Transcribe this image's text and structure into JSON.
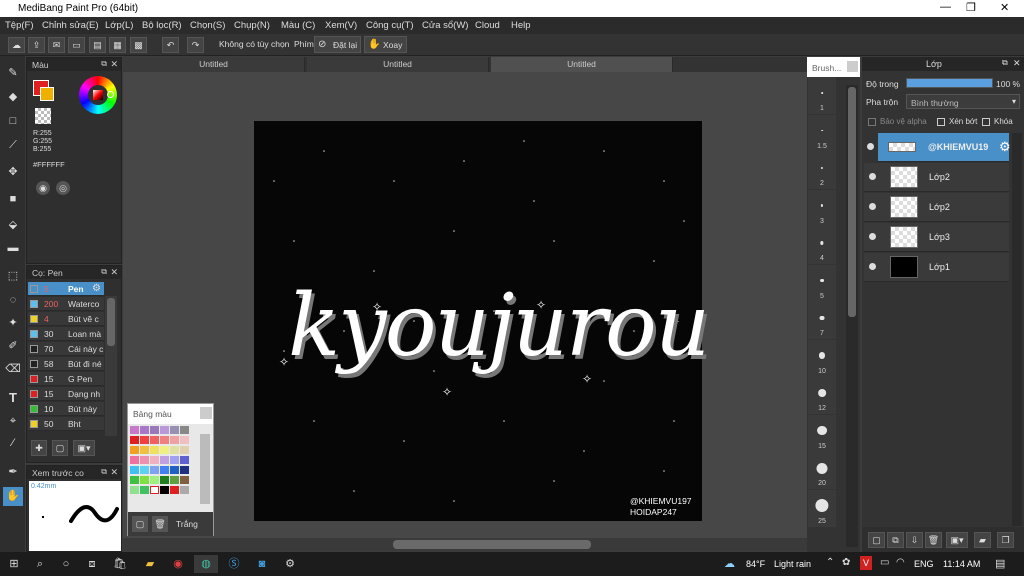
{
  "app": {
    "title": "MediBang Paint Pro (64bit)"
  },
  "menu": [
    "Tệp(F)",
    "Chỉnh sửa(E)",
    "Lớp(L)",
    "Bộ lọc(R)",
    "Chọn(S)",
    "Chụp(N)",
    "Màu (C)",
    "Xem(V)",
    "Công cụ(T)",
    "Cửa sổ(W)",
    "Cloud",
    "Help"
  ],
  "toolbar": {
    "selection_label": "Không có tùy chọn",
    "shortcut_label": "Phím",
    "reset_label": "Đặt lại",
    "rotate_label": "Xoay"
  },
  "color_panel": {
    "title": "Màu",
    "r": "R:255",
    "g": "G:255",
    "b": "B:255",
    "hex": "#FFFFFF"
  },
  "pen_panel": {
    "title": "Cọ: Pen",
    "items": [
      {
        "size": "5",
        "name": "Pen",
        "color": "#4a90c8"
      },
      {
        "size": "200",
        "name": "Waterco",
        "color": "#5bc0f0"
      },
      {
        "size": "4",
        "name": "Bút vẽ c",
        "color": "#f0d020"
      },
      {
        "size": "30",
        "name": "Loan mà",
        "color": "#5bc0f0"
      },
      {
        "size": "70",
        "name": "Cái này c",
        "color": "#222222"
      },
      {
        "size": "58",
        "name": "Bút đi né",
        "color": "#222222"
      },
      {
        "size": "15",
        "name": "G Pen",
        "color": "#e02020"
      },
      {
        "size": "15",
        "name": "Dạng nh",
        "color": "#e02020"
      },
      {
        "size": "10",
        "name": "Bút này",
        "color": "#30c030"
      },
      {
        "size": "50",
        "name": "Bht",
        "color": "#f0d020"
      }
    ]
  },
  "preview_panel": {
    "title": "Xem trước co",
    "size": "0.42mm"
  },
  "palette_panel": {
    "title": "Bảng màu",
    "label": "Trắng"
  },
  "tabs": [
    "Untitled",
    "Untitled",
    "Untitled"
  ],
  "artwork": {
    "text": "kyoujurou",
    "credit1": "@KHIEMVU197",
    "credit2": "HOIDAP247"
  },
  "brush_panel": {
    "title": "Brush...",
    "sizes": [
      "1",
      "1.5",
      "2",
      "3",
      "4",
      "5",
      "7",
      "10",
      "12",
      "15",
      "20",
      "25"
    ]
  },
  "layer_panel": {
    "title": "Lớp",
    "opacity_label": "Độ trong",
    "opacity_value": "100 %",
    "opacity_fraction": 1.0,
    "blend_label": "Pha trộn",
    "blend_value": "Bình thường",
    "protect_alpha": "Bảo vệ alpha",
    "clipping": "Xén bớt",
    "lock": "Khóa",
    "layers": [
      {
        "name": "@KHIEMVU19",
        "selected": true
      },
      {
        "name": "Lớp2",
        "selected": false
      },
      {
        "name": "Lớp2",
        "selected": false
      },
      {
        "name": "Lớp3",
        "selected": false
      },
      {
        "name": "Lớp1",
        "selected": false
      }
    ]
  },
  "taskbar": {
    "weather_temp": "84°F",
    "weather_desc": "Light rain",
    "lang": "ENG",
    "time": "11:14 AM"
  }
}
